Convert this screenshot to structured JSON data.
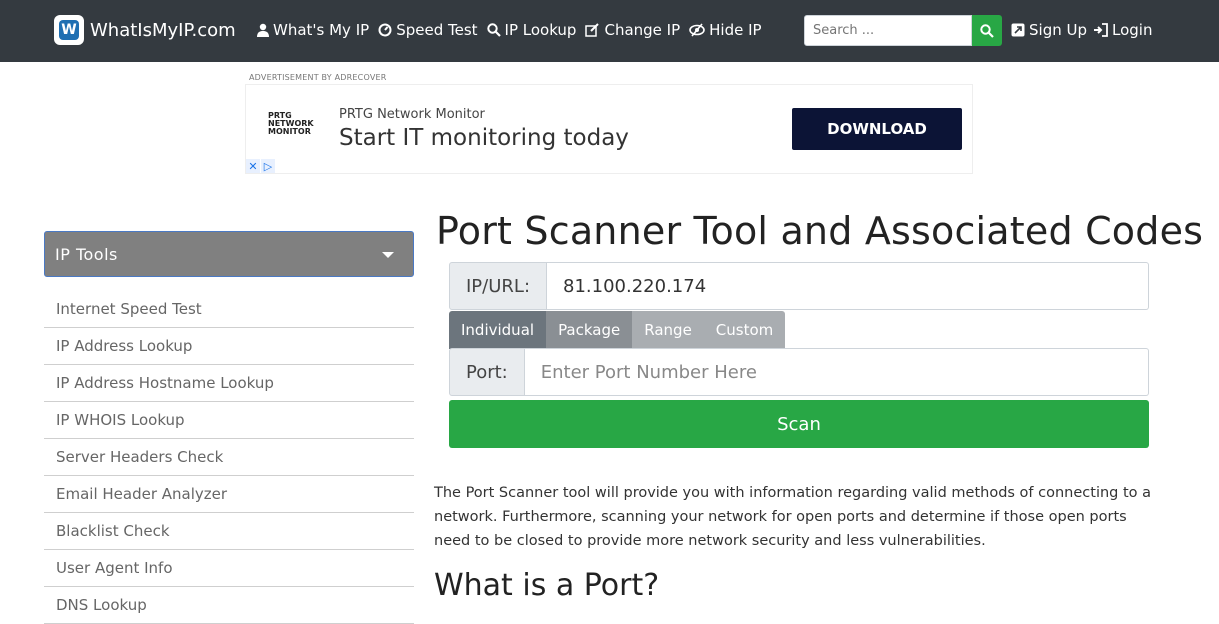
{
  "brand": {
    "name": "WhatIsMyIP.com",
    "logo_letter": "W"
  },
  "nav": [
    {
      "label": "What's My IP",
      "icon": "user-icon"
    },
    {
      "label": "Speed Test",
      "icon": "gauge-icon"
    },
    {
      "label": "IP Lookup",
      "icon": "search-icon"
    },
    {
      "label": "Change IP",
      "icon": "edit-icon"
    },
    {
      "label": "Hide IP",
      "icon": "eye-slash-icon"
    }
  ],
  "search": {
    "placeholder": "Search ..."
  },
  "auth": {
    "signup": "Sign Up",
    "login": "Login"
  },
  "ad": {
    "label": "ADVERTISEMENT BY ADRECOVER",
    "logo_lines": [
      "PRTG",
      "NETWORK",
      "MONITOR"
    ],
    "small": "PRTG Network Monitor",
    "big": "Start IT monitoring today",
    "button": "DOWNLOAD"
  },
  "sidebar": {
    "title": "IP Tools",
    "items": [
      "Internet Speed Test",
      "IP Address Lookup",
      "IP Address Hostname Lookup",
      "IP WHOIS Lookup",
      "Server Headers Check",
      "Email Header Analyzer",
      "Blacklist Check",
      "User Agent Info",
      "DNS Lookup"
    ]
  },
  "main": {
    "title": "Port Scanner Tool and Associated Codes",
    "ip_label": "IP/URL:",
    "ip_value": "81.100.220.174",
    "tabs": [
      "Individual",
      "Package",
      "Range",
      "Custom"
    ],
    "port_label": "Port:",
    "port_placeholder": "Enter Port Number Here",
    "scan_label": "Scan",
    "description": "The Port Scanner tool will provide you with information regarding valid methods of connecting to a network. Furthermore, scanning your network for open ports and determine if those open ports need to be closed to provide more network security and less vulnerabilities.",
    "subheading": "What is a Port?"
  },
  "colors": {
    "navbar": "#343a40",
    "accent": "#28a745",
    "ad_button": "#0c1436"
  }
}
